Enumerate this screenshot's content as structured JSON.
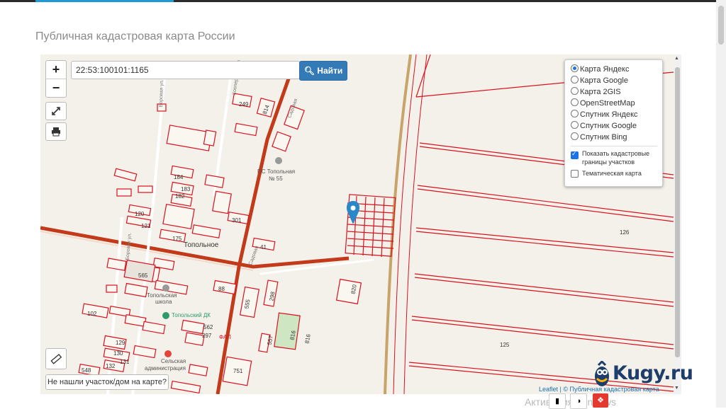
{
  "page": {
    "title": "Публичная кадастровая карта России"
  },
  "search": {
    "value": "22:53:100101:1165",
    "button_label": "Найти"
  },
  "zoom": {
    "in_label": "+",
    "out_label": "−"
  },
  "layers": {
    "options": [
      "Карта Яндекс",
      "Карта Google",
      "Карта 2GIS",
      "OpenStreetMap",
      "Спутник Яндекс",
      "Спутник Google",
      "Спутник Bing"
    ],
    "selected": "Карта Яндекс",
    "show_boundaries_line1": "Показать кадастровые",
    "show_boundaries_line2": "границы участков",
    "show_boundaries_checked": true,
    "thematic_label": "Тематическая карта",
    "thematic_checked": false
  },
  "map_labels": {
    "parcels": [
      "249",
      "814",
      "184",
      "183",
      "182",
      "120",
      "121",
      "301",
      "175",
      "41",
      "565",
      "88",
      "298",
      "555",
      "102",
      "562",
      "297",
      "129",
      "130",
      "131",
      "132",
      "548",
      "751",
      "816",
      "816",
      "557",
      "820",
      "126",
      "125"
    ],
    "streets": [
      "Боровая ул.",
      "Кооперативная",
      "Садовая",
      "Садовая",
      "Боровая ул."
    ],
    "pois": [
      "ПС Топольная",
      "№ 55",
      "Топольное",
      "Топольская",
      "школа",
      "Топольский ДК",
      "ФАП",
      "Сельская",
      "администрация"
    ]
  },
  "colors": {
    "parcel_border": "#d8121f",
    "road": "#c23a1a",
    "primary_button": "#337ab7",
    "marker": "#2b88c8",
    "logo_text": "#1f3d6a"
  },
  "not_found_button": "Не нашли участок/дом на карте?",
  "attribution": "Leaflet | © Публичная кадастровая карта",
  "watermark_text": "Активация Windows",
  "logo": {
    "text": "Kugy.ru"
  },
  "icons": {
    "fullscreen": "expand-icon",
    "print": "printer-icon",
    "ruler": "ruler-icon",
    "search": "search-icon",
    "marker": "map-marker-icon"
  }
}
